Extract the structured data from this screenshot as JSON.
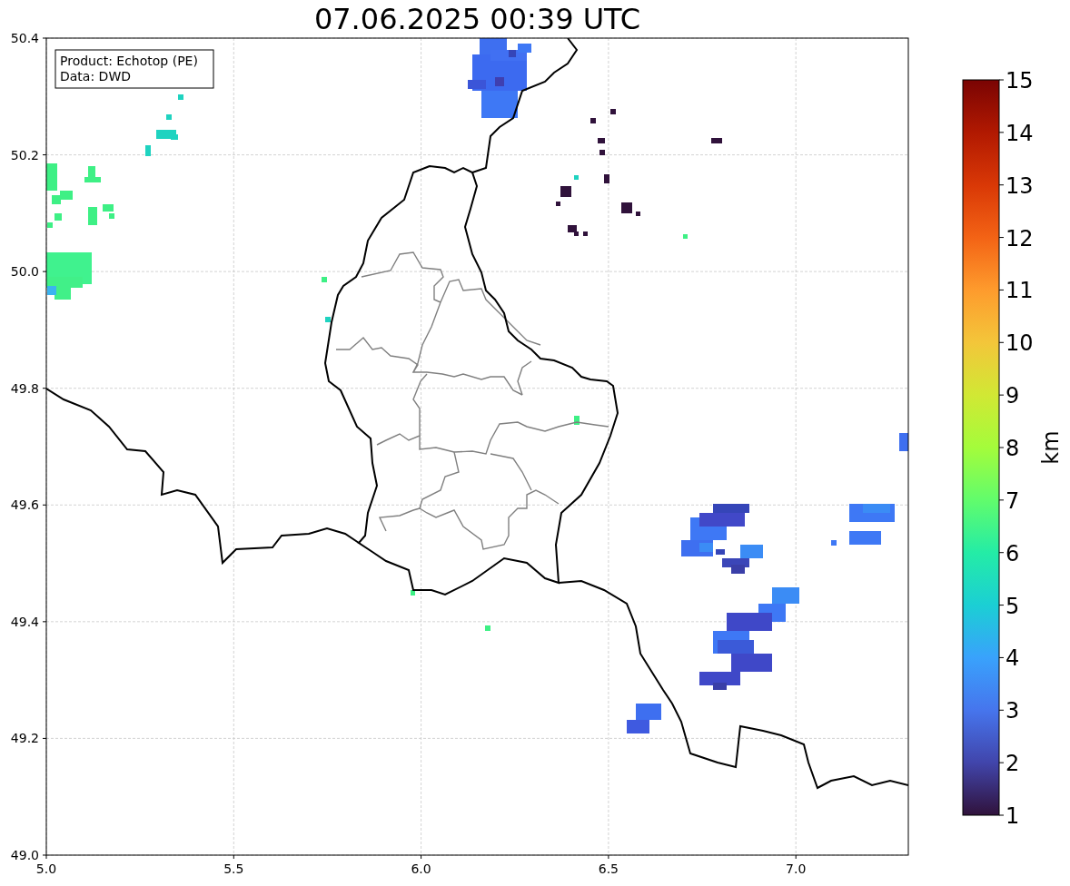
{
  "title": "07.06.2025 00:39 UTC",
  "legend": {
    "lines": [
      "Product: Echotop (PE)",
      "Data: DWD"
    ]
  },
  "x_ticks": [
    "5.0",
    "5.5",
    "6.0",
    "6.5",
    "7.0"
  ],
  "y_ticks": [
    "50.4",
    "50.2",
    "50.0",
    "49.8",
    "49.6",
    "49.4",
    "49.2",
    "49.0"
  ],
  "colorbar": {
    "label": "km",
    "ticks": [
      "15",
      "14",
      "13",
      "12",
      "11",
      "10",
      "9",
      "8",
      "7",
      "6",
      "5",
      "4",
      "3",
      "2",
      "1"
    ]
  }
}
